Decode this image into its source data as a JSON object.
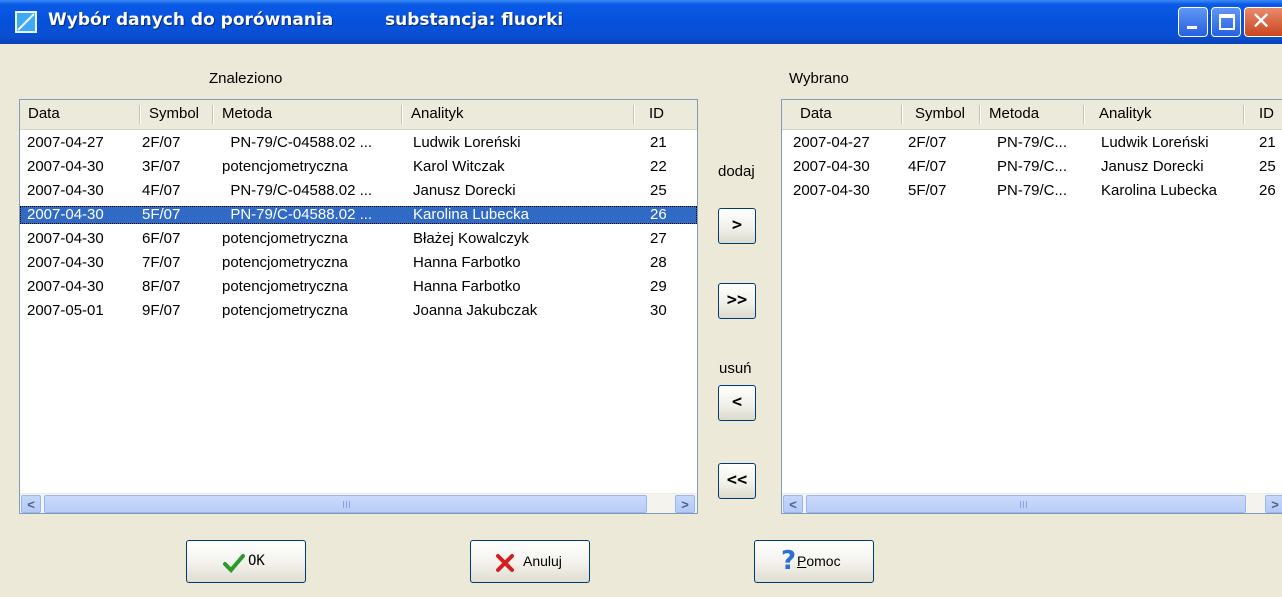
{
  "window": {
    "title": "Wybór danych do porównania",
    "subtitle": "substancja: fluorki"
  },
  "left": {
    "label": "Znaleziono",
    "columns": [
      "Data",
      "Symbol",
      "Metoda",
      "Analityk",
      "ID"
    ],
    "rows": [
      {
        "data": "2007-04-27",
        "symbol": "2F/07",
        "metoda": "  PN-79/C-04588.02 ...",
        "analityk": "Ludwik Loreński",
        "id": "21"
      },
      {
        "data": "2007-04-30",
        "symbol": "3F/07",
        "metoda": "potencjometryczna",
        "analityk": "Karol Witczak",
        "id": "22"
      },
      {
        "data": "2007-04-30",
        "symbol": "4F/07",
        "metoda": "  PN-79/C-04588.02 ...",
        "analityk": "Janusz Dorecki",
        "id": "25"
      },
      {
        "data": "2007-04-30",
        "symbol": "5F/07",
        "metoda": "  PN-79/C-04588.02 ...",
        "analityk": "Karolina Lubecka",
        "id": "26"
      },
      {
        "data": "2007-04-30",
        "symbol": "6F/07",
        "metoda": "potencjometryczna",
        "analityk": "Błażej Kowalczyk",
        "id": "27"
      },
      {
        "data": "2007-04-30",
        "symbol": "7F/07",
        "metoda": "potencjometryczna",
        "analityk": "Hanna Farbotko",
        "id": "28"
      },
      {
        "data": "2007-04-30",
        "symbol": "8F/07",
        "metoda": "potencjometryczna",
        "analityk": "Hanna Farbotko",
        "id": "29"
      },
      {
        "data": "2007-05-01",
        "symbol": "9F/07",
        "metoda": "potencjometryczna",
        "analityk": "Joanna Jakubczak",
        "id": "30"
      }
    ],
    "selected_row": 3
  },
  "right": {
    "label": "Wybrano",
    "columns": [
      "Data",
      "Symbol",
      "Metoda",
      "Analityk",
      "ID"
    ],
    "rows": [
      {
        "data": "2007-04-27",
        "symbol": "2F/07",
        "metoda": "PN-79/C...",
        "analityk": "Ludwik Loreński",
        "id": "21"
      },
      {
        "data": "2007-04-30",
        "symbol": "4F/07",
        "metoda": "PN-79/C...",
        "analityk": "Janusz Dorecki",
        "id": "25"
      },
      {
        "data": "2007-04-30",
        "symbol": "5F/07",
        "metoda": "PN-79/C...",
        "analityk": "Karolina Lubecka",
        "id": "26"
      }
    ]
  },
  "middle": {
    "add_label": "dodaj",
    "add_one": ">",
    "add_all": ">>",
    "remove_label": "usuń",
    "remove_one": "<",
    "remove_all": "<<"
  },
  "scroll": {
    "thumb_grip": "III"
  },
  "buttons": {
    "ok": "OK",
    "cancel": "Anuluj",
    "help_mnemonic": "P",
    "help_rest": "omoc"
  },
  "colors": {
    "selection": "#316ac5",
    "titlebar": "#0651db",
    "face": "#ece9d8"
  }
}
